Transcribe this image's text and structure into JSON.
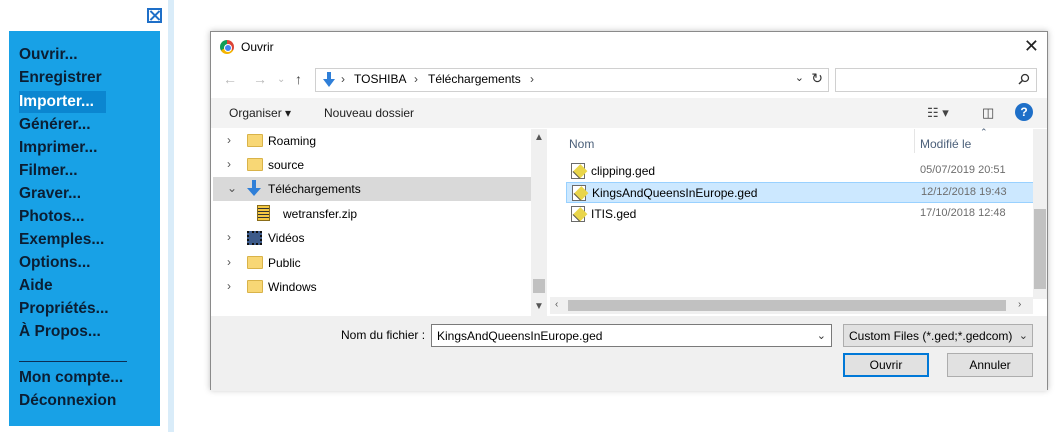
{
  "app_menu": {
    "items": [
      "Ouvrir...",
      "Enregistrer",
      "Importer...",
      "Générer...",
      "Imprimer...",
      "Filmer...",
      "Graver...",
      "Photos...",
      "Exemples...",
      "Options...",
      "Aide",
      "Propriétés...",
      "À Propos..."
    ],
    "active_item": "Importer...",
    "account_items": [
      "Mon compte...",
      "Déconnexion"
    ]
  },
  "dialog": {
    "title": "Ouvrir",
    "breadcrumb": [
      "TOSHIBA",
      "Téléchargements"
    ],
    "search": {
      "placeholder": ""
    },
    "toolbar": {
      "organize": "Organiser ▾",
      "new_folder": "Nouveau dossier"
    },
    "tree": [
      {
        "label": "Roaming",
        "icon": "folder-icon",
        "expanded": false
      },
      {
        "label": "source",
        "icon": "folder-icon",
        "expanded": false
      },
      {
        "label": "Téléchargements",
        "icon": "downloads-icon",
        "expanded": true,
        "selected": true
      },
      {
        "label": "wetransfer.zip",
        "icon": "zip-icon",
        "child": true
      },
      {
        "label": "Vidéos",
        "icon": "video-icon",
        "expanded": false
      },
      {
        "label": "Public",
        "icon": "folder-icon",
        "expanded": false
      },
      {
        "label": "Windows",
        "icon": "folder-icon",
        "expanded": false
      }
    ],
    "columns": {
      "name": "Nom",
      "modified": "Modifié le"
    },
    "files": [
      {
        "name": "clipping.ged",
        "modified": "05/07/2019 20:51",
        "selected": false
      },
      {
        "name": "KingsAndQueensInEurope.ged",
        "modified": "12/12/2018 19:43",
        "selected": true
      },
      {
        "name": "ITIS.ged",
        "modified": "17/10/2018 12:48",
        "selected": false
      }
    ],
    "filename_label": "Nom du fichier :",
    "filename_value": "KingsAndQueensInEurope.ged",
    "filter": "Custom Files (*.ged;*.gedcom)",
    "open_button": "Ouvrir",
    "cancel_button": "Annuler"
  },
  "colors": {
    "menu_bg": "#18a1e6",
    "accent": "#0078d7",
    "selected_file_bg": "#cce8ff"
  }
}
